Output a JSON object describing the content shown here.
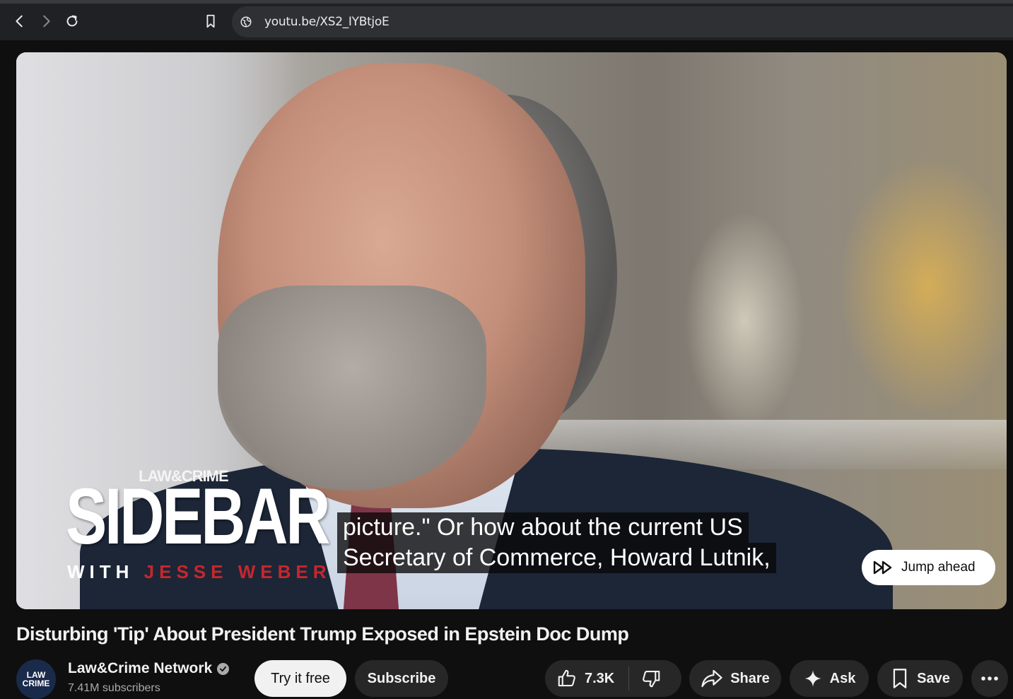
{
  "browser": {
    "url": "youtu.be/XS2_IYBtjoE",
    "icons": [
      "back-icon",
      "forward-icon",
      "reload-icon",
      "bookmark-icon",
      "site-info-icon"
    ]
  },
  "player": {
    "overlay": {
      "brand_small": "LAW&CRIME",
      "show_name": "SIDEBAR",
      "with_label": "WITH",
      "host_name": "JESSE WEBER"
    },
    "captions": [
      "picture.\" Or how about the current US",
      "Secretary of Commerce, Howard Lutnik,"
    ],
    "jump_ahead_label": "Jump ahead"
  },
  "video": {
    "title": "Disturbing 'Tip' About President Trump Exposed in Epstein Doc Dump"
  },
  "channel": {
    "avatar_line1": "LAW",
    "avatar_line2": "CRIME",
    "name": "Law&Crime Network",
    "subscribers": "7.41M subscribers"
  },
  "actions": {
    "try_label": "Try it free",
    "subscribe_label": "Subscribe",
    "like_count": "7.3K",
    "share_label": "Share",
    "ask_label": "Ask",
    "save_label": "Save"
  },
  "colors": {
    "page_bg": "#0f0f0f",
    "pill_bg": "#272727",
    "host_red": "#c8262c"
  }
}
